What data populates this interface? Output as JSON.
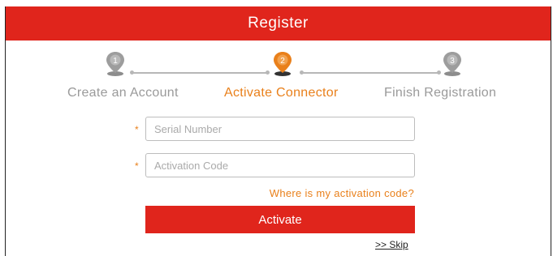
{
  "header": {
    "title": "Register"
  },
  "steps": [
    {
      "number": "1",
      "label": "Create an Account",
      "state": "done"
    },
    {
      "number": "2",
      "label": "Activate Connector",
      "state": "active"
    },
    {
      "number": "3",
      "label": "Finish Registration",
      "state": "pending"
    }
  ],
  "form": {
    "required_mark": "*",
    "serial_placeholder": "Serial Number",
    "serial_value": "",
    "activation_placeholder": "Activation Code",
    "activation_value": "",
    "help_link": "Where is my activation code?",
    "activate_label": "Activate",
    "skip_label": ">> Skip"
  },
  "colors": {
    "brand_red": "#e0251c",
    "accent_orange": "#e9801b",
    "inactive_gray": "#9a9a9a"
  },
  "icons": {
    "step_marker": "location-pin-icon"
  }
}
